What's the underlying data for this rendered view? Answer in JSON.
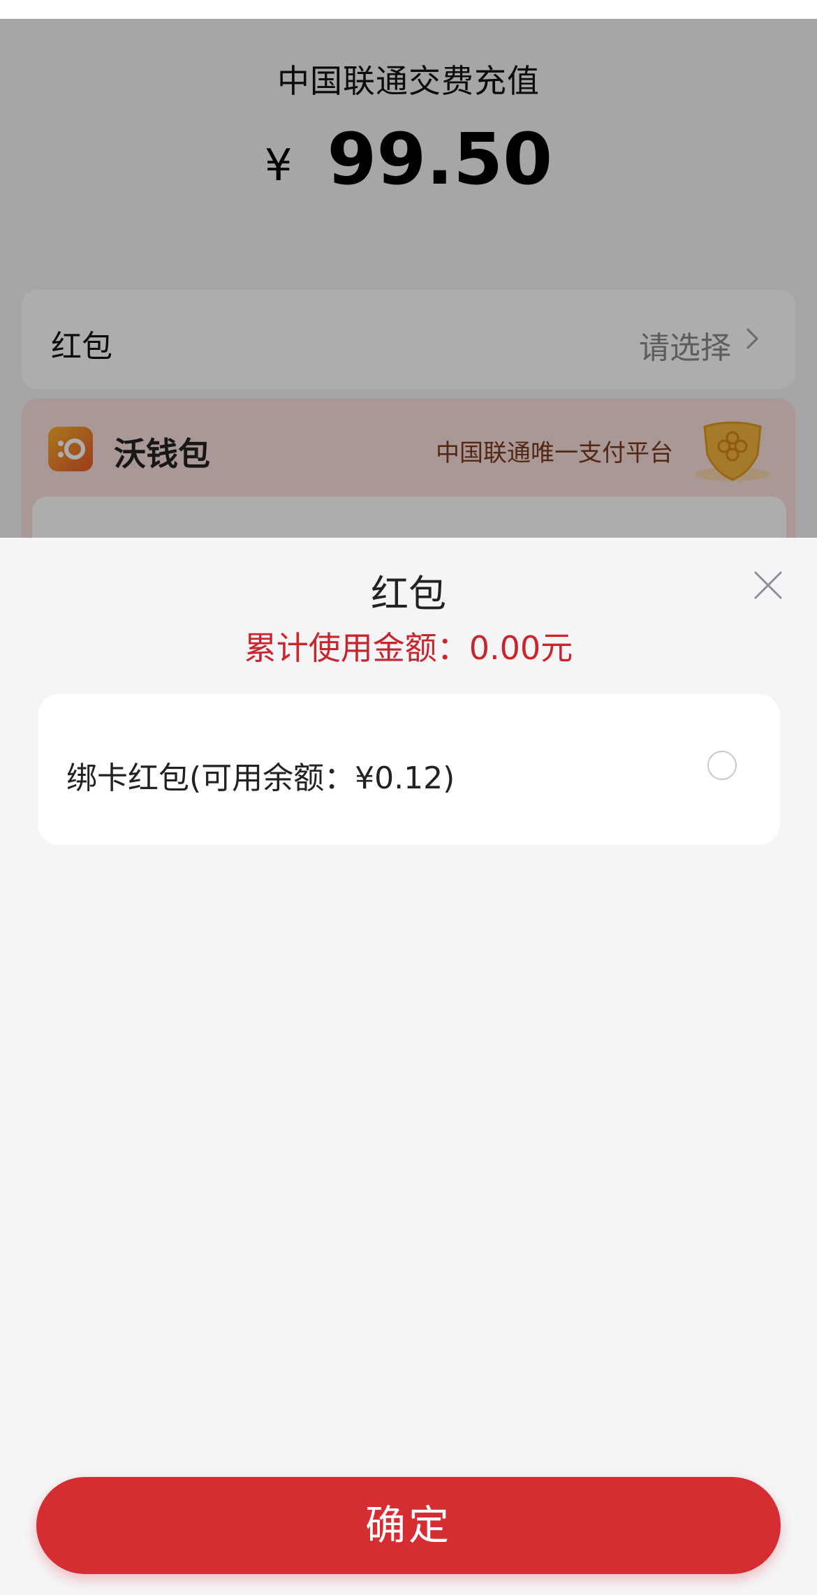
{
  "order": {
    "title": "中国联通交费充值",
    "currency": "¥",
    "amount": "99.50"
  },
  "hongbao_row": {
    "label": "红包",
    "placeholder": "请选择"
  },
  "wallet": {
    "name": "沃钱包",
    "slogan": "中国联通唯一支付平台"
  },
  "sheet": {
    "title": "红包",
    "subtitle": "累计使用金额：0.00元",
    "vouchers": [
      {
        "label": "绑卡红包(可用余额：¥0.12)",
        "selected": false
      }
    ],
    "confirm_label": "确定"
  },
  "colors": {
    "accent_red": "#d62d33",
    "subtitle_red": "#c8262c",
    "sheet_background": "#f5f5f7"
  },
  "icons": {
    "close": "close-icon",
    "chevron": "chevron-right-icon",
    "wallet_logo": "wo-wallet-logo-icon",
    "shield": "china-unicom-shield-icon"
  }
}
